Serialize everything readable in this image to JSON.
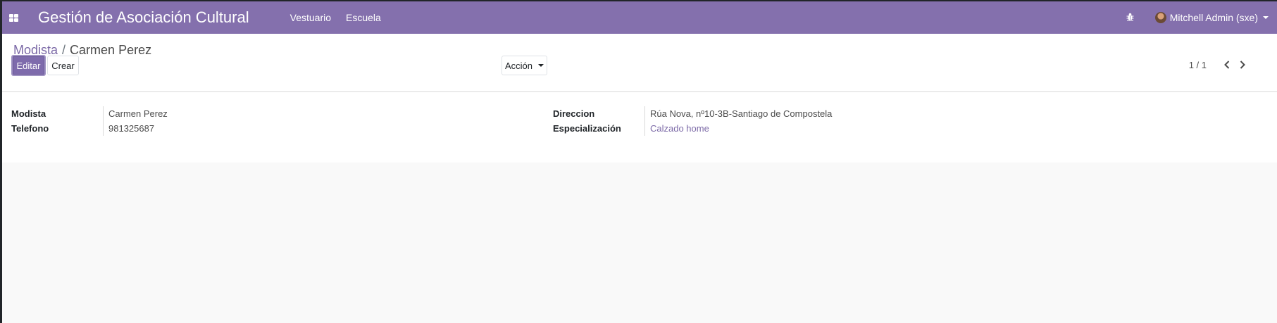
{
  "navbar": {
    "apps_icon": "apps-grid-icon",
    "brand": "Gestión de Asociación Cultural",
    "menu": [
      {
        "label": "Vestuario"
      },
      {
        "label": "Escuela"
      }
    ],
    "debug_icon": "bug-icon",
    "user_name": "Mitchell Admin (sxe)",
    "accent_color": "#8470ad"
  },
  "breadcrumb": {
    "parent": "Modista",
    "separator": "/",
    "current": "Carmen Perez"
  },
  "toolbar": {
    "edit_label": "Editar",
    "create_label": "Crear",
    "action_label": "Acción"
  },
  "pager": {
    "value": "1 / 1"
  },
  "form": {
    "left": [
      {
        "label": "Modista",
        "value": "Carmen Perez"
      },
      {
        "label": "Telefono",
        "value": "981325687"
      }
    ],
    "right": [
      {
        "label": "Direccion",
        "value": "Rúa Nova, nº10-3B-Santiago de Compostela"
      },
      {
        "label": "Especialización",
        "value": "Calzado home"
      }
    ]
  }
}
